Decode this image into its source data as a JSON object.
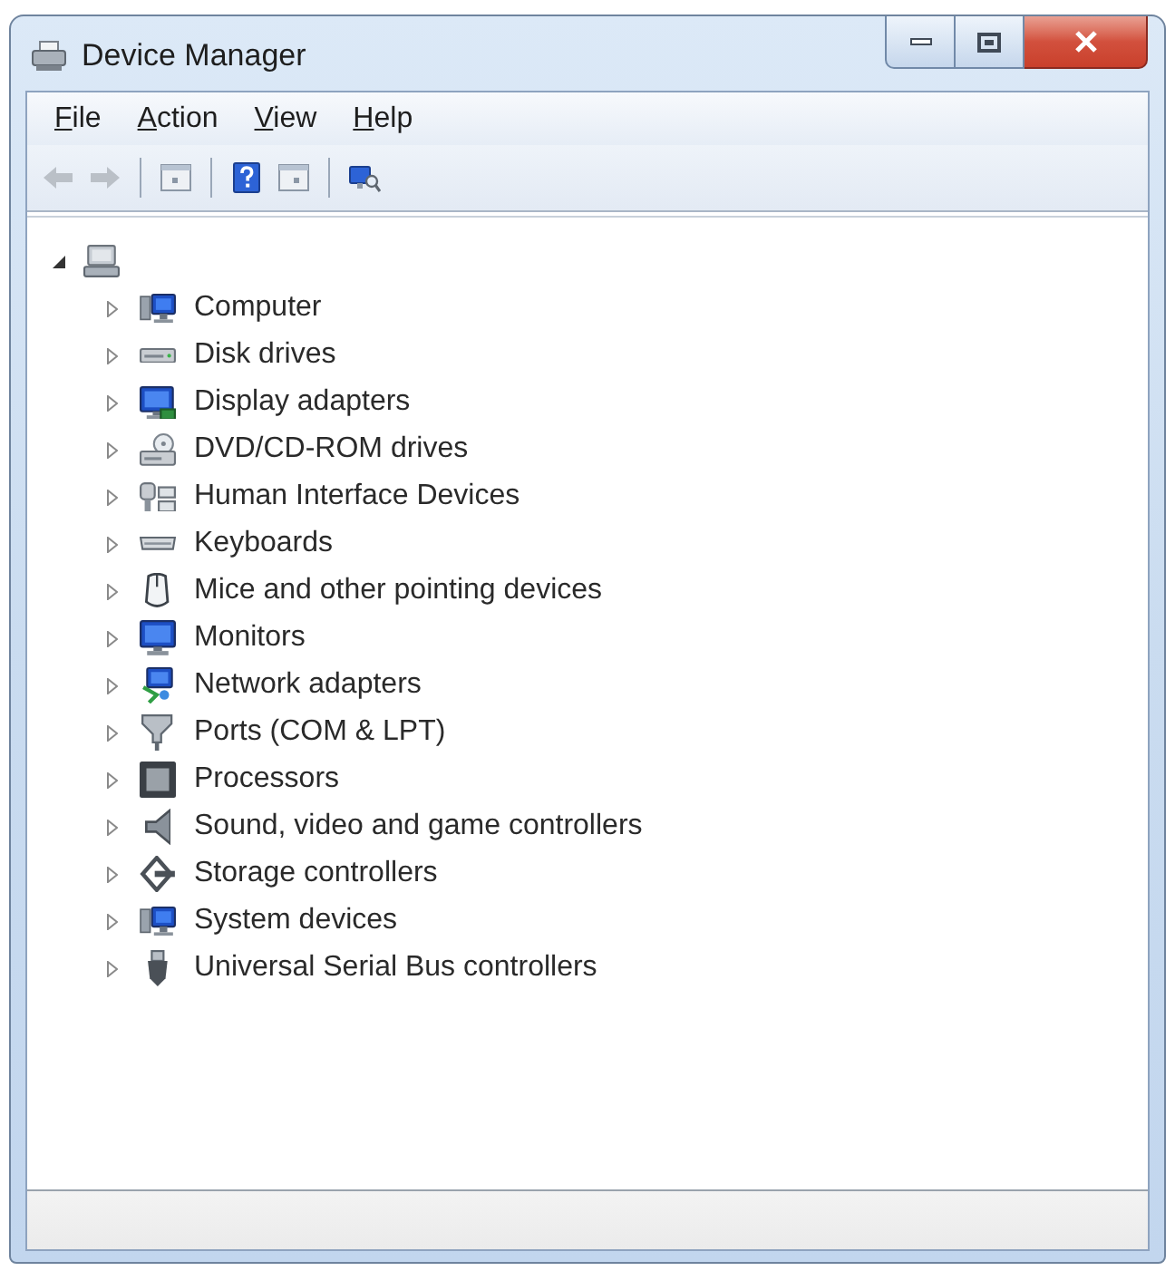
{
  "window": {
    "title": "Device Manager"
  },
  "menu_bar": [
    {
      "label": "File"
    },
    {
      "label": "Action"
    },
    {
      "label": "View"
    },
    {
      "label": "Help"
    }
  ],
  "toolbar": {
    "groups": [
      {
        "buttons": [
          {
            "kind": "back",
            "disabled": true
          },
          {
            "kind": "forward",
            "disabled": true
          }
        ]
      },
      {
        "buttons": [
          {
            "kind": "console_tree",
            "disabled": false
          }
        ]
      },
      {
        "buttons": [
          {
            "kind": "help",
            "disabled": false
          },
          {
            "kind": "action_pane",
            "disabled": false
          }
        ]
      },
      {
        "buttons": [
          {
            "kind": "scan",
            "disabled": false
          }
        ]
      }
    ]
  },
  "tree": {
    "root": {
      "expanded": true,
      "children": [
        {
          "label": "Computer",
          "expanded": false
        },
        {
          "label": "Disk drives",
          "expanded": false
        },
        {
          "label": "Display adapters",
          "expanded": false
        },
        {
          "label": "DVD/CD-ROM drives",
          "expanded": false
        },
        {
          "label": "Human Interface Devices",
          "expanded": false
        },
        {
          "label": "Keyboards",
          "expanded": false
        },
        {
          "label": "Mice and other pointing devices",
          "expanded": false
        },
        {
          "label": "Monitors",
          "expanded": false
        },
        {
          "label": "Network adapters",
          "expanded": false
        },
        {
          "label": "Ports (COM & LPT)",
          "expanded": false
        },
        {
          "label": "Processors",
          "expanded": false
        },
        {
          "label": "Sound, video and game controllers",
          "expanded": false
        },
        {
          "label": "Storage controllers",
          "expanded": false
        },
        {
          "label": "System devices",
          "expanded": false
        },
        {
          "label": "Universal Serial Bus controllers",
          "expanded": false
        }
      ]
    }
  }
}
